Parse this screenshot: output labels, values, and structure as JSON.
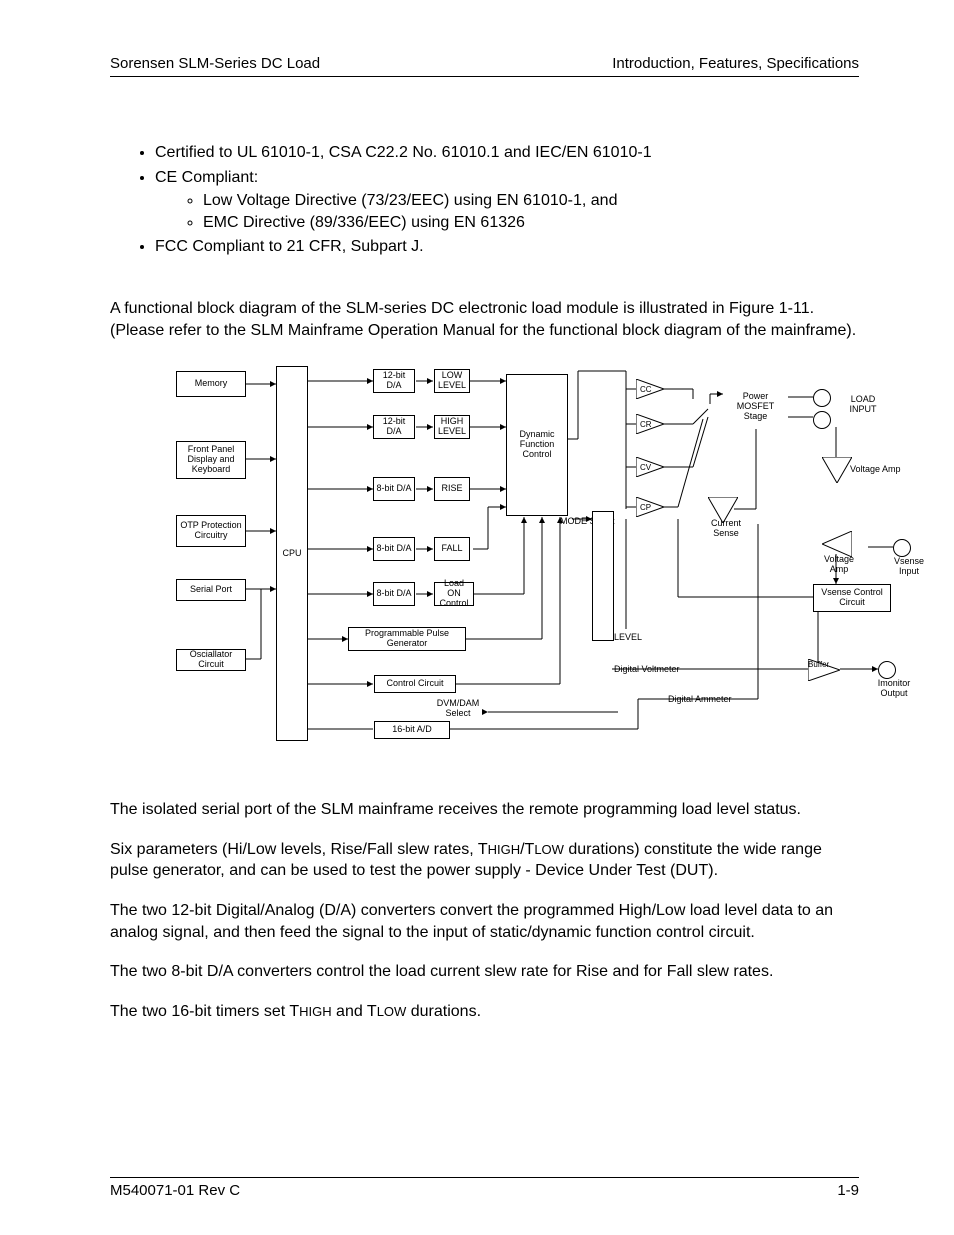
{
  "header": {
    "left": "Sorensen SLM-Series DC Load",
    "right": "Introduction, Features, Specifications"
  },
  "bullets": {
    "b1": "Certified to UL 61010-1, CSA C22.2 No. 61010.1 and IEC/EN 61010-1",
    "b2": "CE Compliant:",
    "b2a": "Low Voltage Directive (73/23/EEC) using EN 61010-1, and",
    "b2b": "EMC Directive (89/336/EEC) using EN 61326",
    "b3": "FCC Compliant to 21 CFR, Subpart J."
  },
  "intro": "A functional block diagram of the SLM-series DC electronic load module is illustrated in Figure 1-11. (Please refer to the SLM Mainframe Operation Manual for the functional block diagram of the mainframe).",
  "p1": "The isolated serial port of the SLM mainframe receives the remote programming load level status.",
  "p2_a": "Six parameters (Hi/Low levels, Rise/Fall slew rates, T",
  "p2_b": "/T",
  "p2_c": " durations) constitute the wide range pulse generator, and can be used to test the power supply - Device Under Test (DUT).",
  "p3": "The two 12-bit Digital/Analog (D/A) converters convert the programmed High/Low load level data to an analog signal, and then feed the signal to the input of static/dynamic function control circuit.",
  "p4": "The two 8-bit D/A converters control the load current slew rate for Rise and for Fall slew rates.",
  "p5_a": "The two 16-bit timers set T",
  "p5_b": " and T",
  "p5_c": " durations.",
  "sc_high": "HIGH",
  "sc_low": "LOW",
  "diag": {
    "memory": "Memory",
    "front_panel": "Front Panel Display and Keyboard",
    "otp": "OTP Protection Circuitry",
    "serial": "Serial Port",
    "osc": "Osciallator Circuit",
    "cpu": "CPU",
    "da12_1": "12-bit D/A",
    "da12_2": "12-bit D/A",
    "da8_1": "8-bit D/A",
    "da8_2": "8-bit D/A",
    "da8_3": "8-bit D/A",
    "lowlev": "LOW LEVEL",
    "highlev": "HIGH LEVEL",
    "rise": "RISE",
    "fall": "FALL",
    "loadon": "Load ON Control",
    "ppg": "Programmable Pulse Generator",
    "ctrl": "Control Circuit",
    "ad16": "16-bit A/D",
    "dvmdam": "DVM/DAM Select",
    "dyn": "Dynamic Function Control",
    "modesel": "MODE Select",
    "cc": "CC",
    "cr": "CR",
    "cv": "CV",
    "cp": "CP",
    "level": "LEVEL",
    "mosfet": "Power MOSFET Stage",
    "loadin": "LOAD INPUT",
    "vamp": "Voltage Amp",
    "vamp2": "Voltage Amp",
    "csense": "Current Sense",
    "vsensein": "Vsense Input",
    "vsensectrl": "Vsense Control Circuit",
    "dvm": "Digital Voltmeter",
    "damm": "Digital Ammeter",
    "buffer": "Buffer",
    "imon": "Imonitor Output"
  },
  "footer": {
    "left": "M540071-01 Rev C",
    "right": "1-9"
  }
}
